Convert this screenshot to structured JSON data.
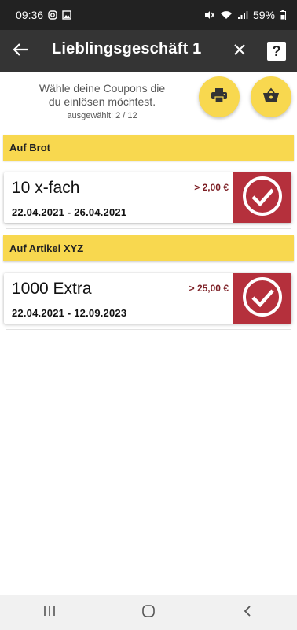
{
  "status_bar": {
    "time": "09:36",
    "battery": "59%",
    "left_icons": [
      "instagram-icon",
      "gallery-icon"
    ],
    "right_icons": [
      "mute-icon",
      "wifi-icon",
      "signal-icon",
      "battery-icon"
    ]
  },
  "app_bar": {
    "title": "Lieblingsgeschäft 1",
    "help_label": "?"
  },
  "header": {
    "line1": "Wähle deine Coupons die",
    "line2": "du einlösen möchtest.",
    "selected": "ausgewählt: 2 / 12",
    "print_icon": "printer-icon",
    "basket_icon": "basket-icon"
  },
  "sections": [
    {
      "title": "Auf Brot",
      "coupons": [
        {
          "name": "10 x-fach",
          "min_amount": "> 2,00 €",
          "dates": "22.04.2021 - 26.04.2021",
          "selected": true
        }
      ]
    },
    {
      "title": "Auf Artikel XYZ",
      "coupons": [
        {
          "name": "1000 Extra",
          "min_amount": "> 25,00 €",
          "dates": "22.04.2021 - 12.09.2023",
          "selected": true
        }
      ]
    }
  ],
  "colors": {
    "accent_yellow": "#f8d84f",
    "check_red": "#b5303c",
    "app_bar": "#343434",
    "status_bar": "#222222",
    "price_red": "#7c1e24"
  },
  "nav_bar": {
    "icons": [
      "recent-apps-icon",
      "home-icon",
      "back-nav-icon"
    ]
  }
}
